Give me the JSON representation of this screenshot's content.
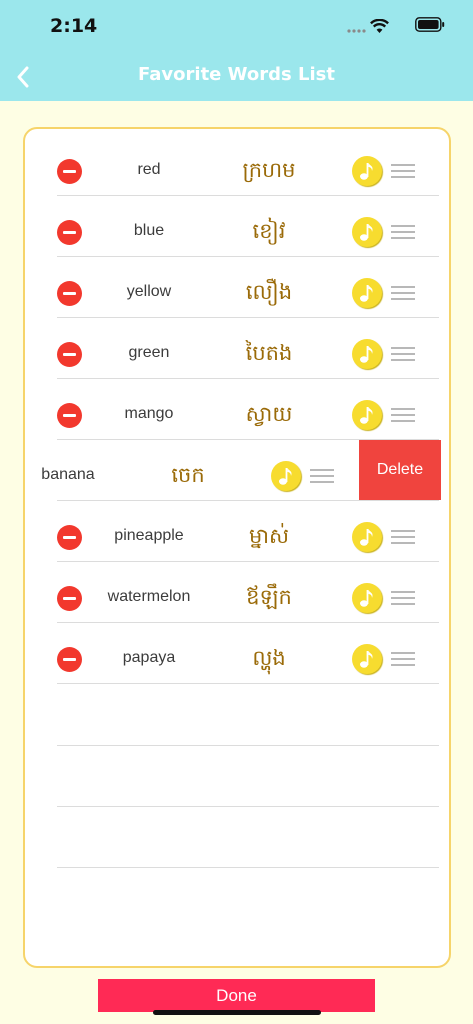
{
  "status_bar": {
    "time": "2:14"
  },
  "nav": {
    "title": "Favorite Words List",
    "back_icon": "chevron-left-icon"
  },
  "words": [
    {
      "english": "red",
      "khmer": "ក្រហម"
    },
    {
      "english": "blue",
      "khmer": "ខៀវ"
    },
    {
      "english": "yellow",
      "khmer": "លឿង"
    },
    {
      "english": "green",
      "khmer": "បៃតង"
    },
    {
      "english": "mango",
      "khmer": "ស្វាយ"
    },
    {
      "english": "banana",
      "khmer": "ចេក",
      "swiped": true
    },
    {
      "english": "pineapple",
      "khmer": "ម្នាស់"
    },
    {
      "english": "watermelon",
      "khmer": "ឪឡឹក"
    },
    {
      "english": "papaya",
      "khmer": "ល្ហុង"
    }
  ],
  "delete_label": "Delete",
  "done_label": "Done",
  "colors": {
    "header": "#9be7ec",
    "background": "#fefee4",
    "card_border": "#f6d46a",
    "delete": "#f0443e",
    "done": "#ff2a55",
    "play": "#f7dc2f",
    "khmer_text": "#9a6a08"
  }
}
